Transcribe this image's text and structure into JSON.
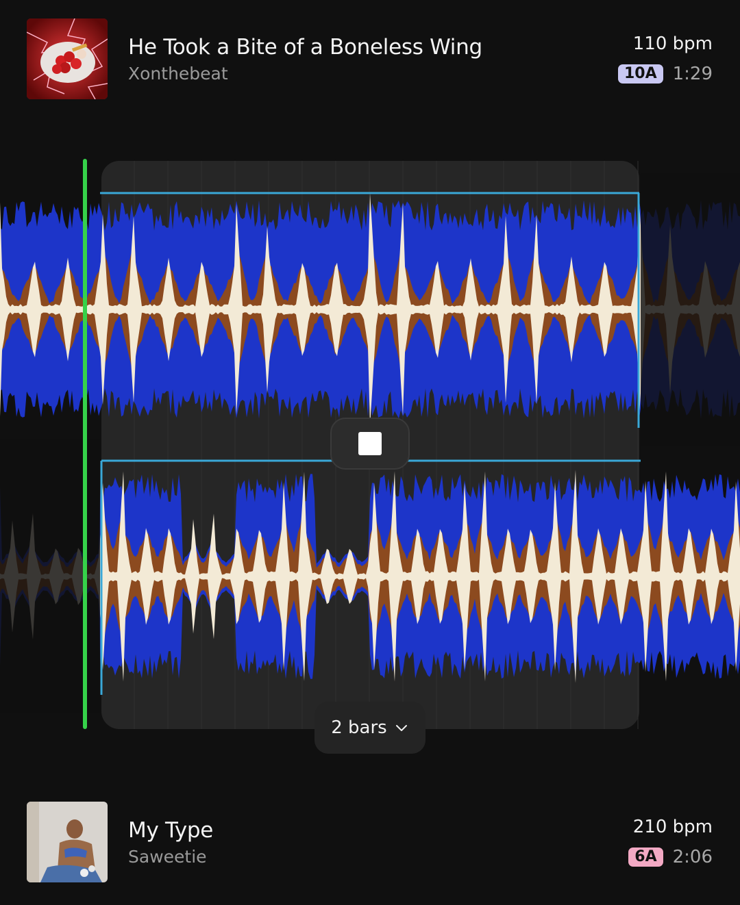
{
  "track_top": {
    "title": "He Took a Bite of a Boneless Wing",
    "artist": "Xonthebeat",
    "bpm": "110 bpm",
    "key": "10A",
    "key_color": "#c9c8f2",
    "duration": "1:29",
    "artwork_icon": "album-art-chicken-wings"
  },
  "track_bottom": {
    "title": "My Type",
    "artist": "Saweetie",
    "bpm": "210 bpm",
    "key": "6A",
    "key_color": "#f3a9c4",
    "duration": "2:06",
    "artwork_icon": "album-art-icy"
  },
  "controls": {
    "stop_icon": "stop-icon",
    "loop_length": "2 bars",
    "loop_chevron_icon": "chevron-down-icon"
  },
  "colors": {
    "playhead": "#36d24a",
    "loop_marker": "#3aa8d8",
    "wave_low": "#1d35c9",
    "wave_mid": "#8c4a1f",
    "wave_high": "#f3ead6"
  }
}
